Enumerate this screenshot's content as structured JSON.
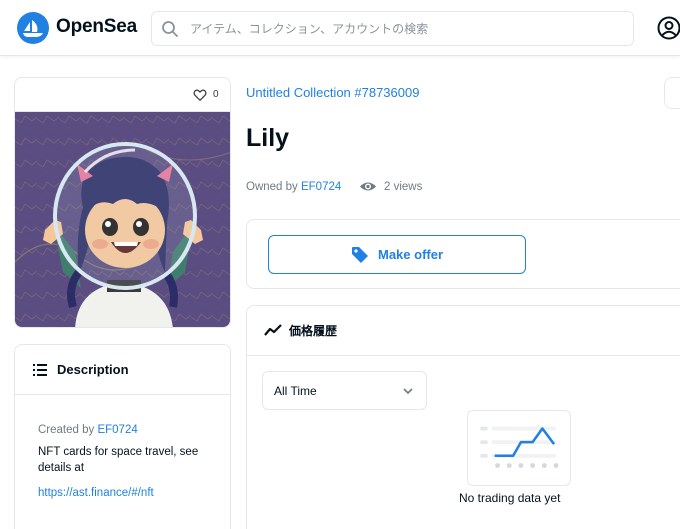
{
  "header": {
    "brand": "OpenSea",
    "search_placeholder": "アイテム、コレクション、アカウントの検索"
  },
  "asset": {
    "favorites": "0",
    "collection": "Untitled Collection #78736009",
    "name": "Lily",
    "owned_by_label": "Owned by",
    "owner": "EF0724",
    "views": "2 views"
  },
  "description": {
    "title": "Description",
    "created_by_label": "Created by",
    "creator": "EF0724",
    "text": "NFT cards for space travel, see details at",
    "link": "https://ast.finance/#/nft"
  },
  "offer": {
    "label": "Make offer"
  },
  "price_history": {
    "title": "価格履歴",
    "range": "All Time",
    "empty_message": "No trading data yet"
  },
  "colors": {
    "accent": "#2081e2",
    "border": "#e5e8eb",
    "muted": "#707a83"
  },
  "icons": [
    "opensea-logo-icon",
    "search-icon",
    "profile-icon",
    "heart-icon",
    "description-lines-icon",
    "eye-icon",
    "tag-icon",
    "trend-icon",
    "chevron-down-icon",
    "empty-chart-icon"
  ]
}
